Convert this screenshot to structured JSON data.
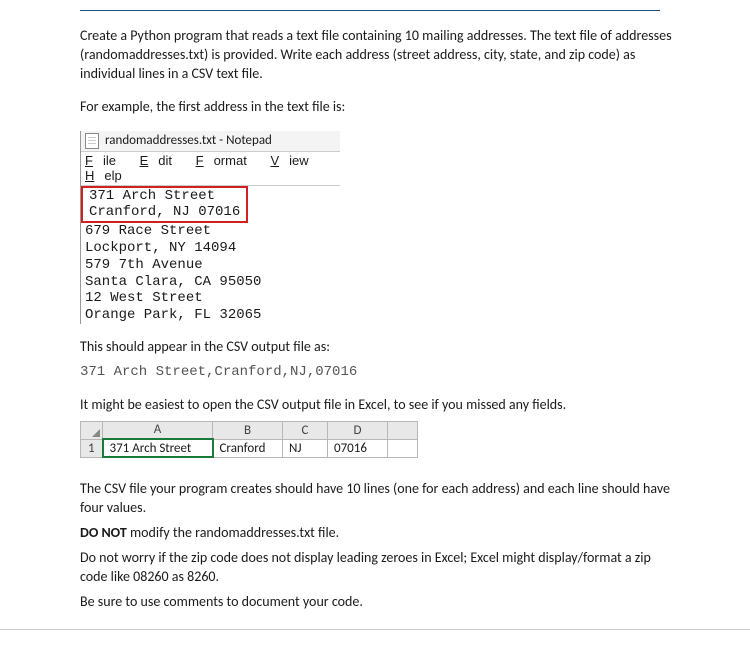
{
  "instructions": {
    "para1": "Create a Python program that reads a text file containing 10 mailing addresses. The text file of addresses (randomaddresses.txt) is provided. Write each address (street address, city, state, and zip code) as individual lines in a CSV text file.",
    "para2": "For example, the first address in the text file is:",
    "para3": "This should appear in the CSV output file as:",
    "csv_example": "371 Arch Street,Cranford,NJ,07016",
    "para4": "It might be easiest to open the CSV output file in Excel, to see if you missed any fields.",
    "para5": "The CSV file your program creates should have 10 lines (one for each address) and each line should have four values.",
    "para6a": "DO NOT",
    "para6b": " modify the randomaddresses.txt file.",
    "para7": "Do not worry if the zip code does not display leading zeroes in Excel; Excel might display/format a zip code like 08260 as 8260.",
    "para8": "Be sure to use comments to document your code."
  },
  "notepad": {
    "title": "randomaddresses.txt - Notepad",
    "menu": {
      "file_u": "F",
      "file": "ile",
      "edit_u": "E",
      "edit": "dit",
      "format_u": "F",
      "format": "ormat",
      "view_u": "V",
      "view": "iew",
      "help_u": "H",
      "help": "elp"
    },
    "highlight_lines": [
      "371 Arch Street",
      "Cranford, NJ 07016"
    ],
    "lines": [
      "679 Race Street",
      "Lockport, NY 14094",
      "579 7th Avenue",
      "Santa Clara, CA 95050",
      "12 West Street",
      "Orange Park, FL 32065"
    ]
  },
  "excel": {
    "headers": [
      "A",
      "B",
      "C",
      "D"
    ],
    "row_number": "1",
    "cells": {
      "a": "371 Arch Street",
      "b": "Cranford",
      "c": "NJ",
      "d": "07016"
    }
  }
}
